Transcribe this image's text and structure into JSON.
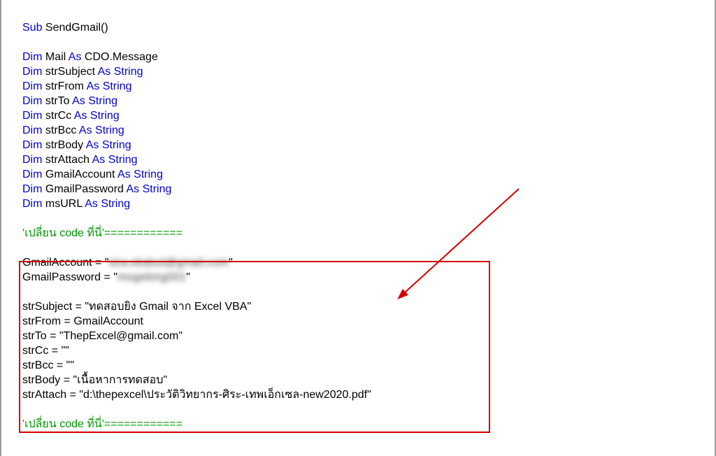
{
  "code": {
    "l01_sub": "Sub",
    "l01_name": "SendGmail()",
    "dim": "Dim",
    "as": "As",
    "v_mail": "Mail",
    "t_cdo": "CDO.Message",
    "v_subject": "strSubject",
    "v_from": "strFrom",
    "v_to": "strTo",
    "v_cc": "strCc",
    "v_bcc": "strBcc",
    "v_body": "strBody",
    "v_attach": "strAttach",
    "v_gacct": "GmailAccount",
    "v_gpass": "GmailPassword",
    "v_msurl": "msURL",
    "t_string": "String",
    "comment_marker": "'เปลี่ยน code ที่นี่'============",
    "assign1a": "GmailAccount = \"",
    "assign1b_blur": "sira.ekabut@gmail.com",
    "assign1c": "\"",
    "assign2a": "GmailPassword = \"",
    "assign2b_blur": "mogeking001",
    "assign2c": "\"",
    "assign3": "strSubject = \"ทดสอบยิง Gmail จาก Excel VBA\"",
    "assign4": "strFrom = GmailAccount",
    "assign5": "strTo = \"ThepExcel@gmail.com\"",
    "assign6": "strCc = \"\"",
    "assign7": "strBcc = \"\"",
    "assign8": "strBody = \"เนื้อหาการทดสอบ\"",
    "assign9": "strAttach = \"d:\\thepexcel\\ประวัติวิทยากร-ศิระ-เทพเอ็กเซล-new2020.pdf\""
  }
}
